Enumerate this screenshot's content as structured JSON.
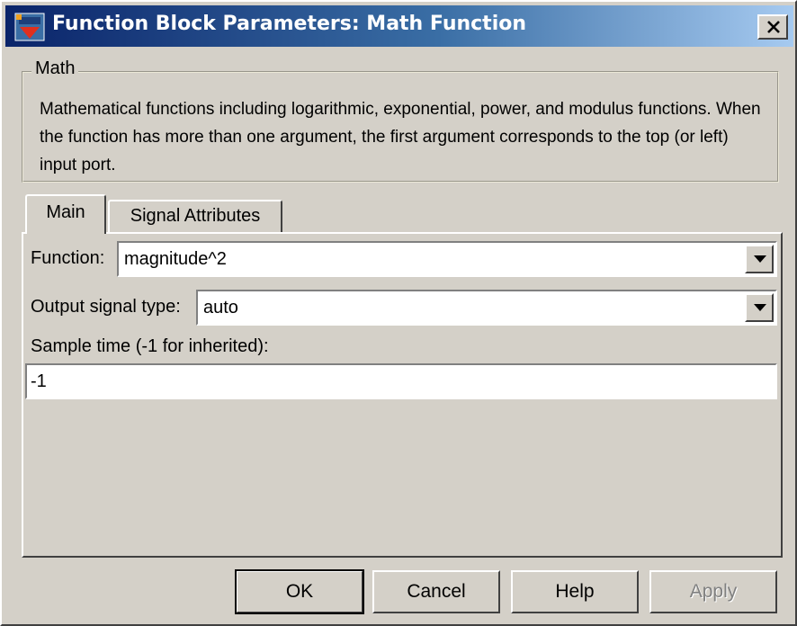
{
  "window": {
    "title": "Function Block Parameters: Math Function",
    "colors": {
      "titlebar_start": "#0a246a",
      "titlebar_end": "#a6caf0",
      "face": "#d4d0c8"
    }
  },
  "group": {
    "title": "Math",
    "description": "Mathematical functions including logarithmic, exponential, power, and modulus functions.  When the function has more than one argument, the first argument corresponds to the top (or left) input port."
  },
  "tabs": [
    {
      "label": "Main",
      "selected": true
    },
    {
      "label": "Signal Attributes",
      "selected": false
    }
  ],
  "main": {
    "function_label": "Function:",
    "function_value": "magnitude^2",
    "output_label": "Output signal type:",
    "output_value": "auto",
    "sample_label": "Sample time (-1 for inherited):",
    "sample_value": "-1"
  },
  "buttons": {
    "ok": "OK",
    "cancel": "Cancel",
    "help": "Help",
    "apply": "Apply"
  },
  "icons": {
    "app": "simulink-block-icon",
    "close": "close-icon",
    "dropdown": "chevron-down-icon"
  }
}
